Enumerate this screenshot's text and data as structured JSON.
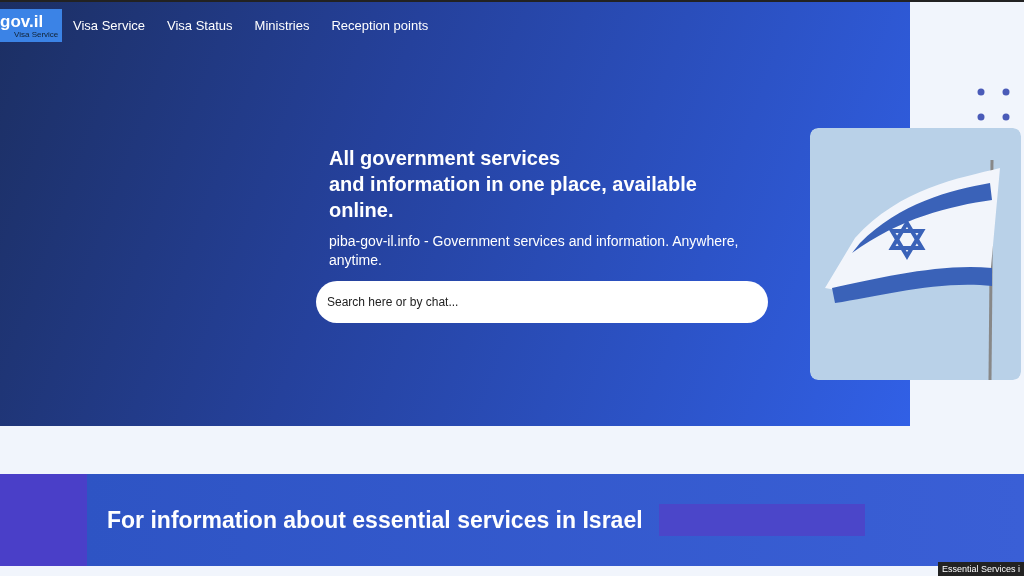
{
  "logo": {
    "title": "gov.il",
    "subtitle": "Visa Service"
  },
  "nav": [
    {
      "label": "Visa Service"
    },
    {
      "label": "Visa Status"
    },
    {
      "label": "Ministries"
    },
    {
      "label": "Reception points"
    }
  ],
  "hero": {
    "heading_lines": [
      "All government services",
      "and information in one place, available",
      "online."
    ],
    "description": "piba-gov-il.info - Government services and information. Anywhere, anytime.",
    "search": {
      "placeholder": "Search here or by chat..."
    }
  },
  "banner": {
    "text": "For information about essential services in Israel"
  },
  "tooltip": {
    "text": "Essential Services i"
  }
}
